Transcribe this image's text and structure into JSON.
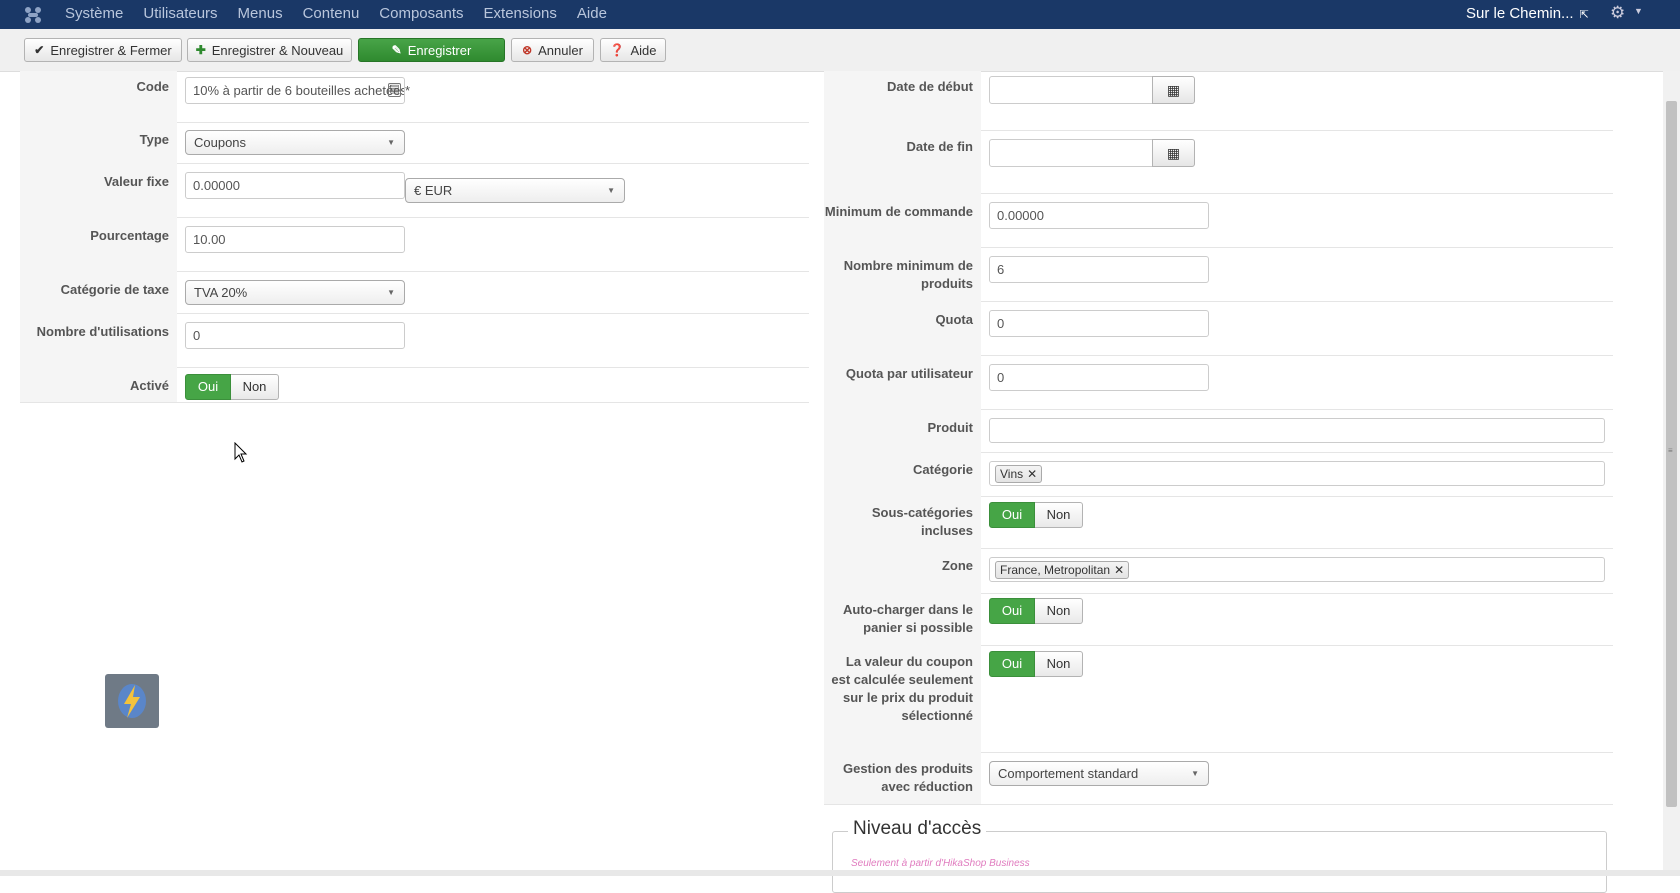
{
  "navbar": {
    "menu": [
      "Système",
      "Utilisateurs",
      "Menus",
      "Contenu",
      "Composants",
      "Extensions",
      "Aide"
    ],
    "site": "Sur le Chemin...",
    "external_icon": "external-link-icon",
    "settings_icon": "gear-icon"
  },
  "toolbar": {
    "save_close": "Enregistrer & Fermer",
    "save_new": "Enregistrer & Nouveau",
    "save": "Enregistrer",
    "cancel": "Annuler",
    "help": "Aide"
  },
  "left": {
    "code": {
      "label": "Code",
      "value": "10% à partir de 6 bouteilles achetées",
      "required": "*"
    },
    "type": {
      "label": "Type",
      "value": "Coupons"
    },
    "fixed_value": {
      "label": "Valeur fixe",
      "value": "0.00000",
      "currency": "€ EUR"
    },
    "percentage": {
      "label": "Pourcentage",
      "value": "10.00"
    },
    "tax_category": {
      "label": "Catégorie de taxe",
      "value": "TVA 20%"
    },
    "uses": {
      "label": "Nombre d'utilisations",
      "value": "0"
    },
    "active": {
      "label": "Activé",
      "yes": "Oui",
      "no": "Non",
      "state": "Oui"
    }
  },
  "right": {
    "start_date": {
      "label": "Date de début",
      "value": ""
    },
    "end_date": {
      "label": "Date de fin",
      "value": ""
    },
    "min_order": {
      "label": "Minimum de commande",
      "value": "0.00000"
    },
    "min_products": {
      "label": "Nombre minimum de produits",
      "value": "6"
    },
    "quota": {
      "label": "Quota",
      "value": "0"
    },
    "quota_user": {
      "label": "Quota par utilisateur",
      "value": "0"
    },
    "product": {
      "label": "Produit",
      "value": ""
    },
    "category": {
      "label": "Catégorie",
      "tags": [
        "Vins"
      ]
    },
    "subcategories": {
      "label": "Sous-catégories incluses",
      "yes": "Oui",
      "no": "Non",
      "state": "Oui"
    },
    "zone": {
      "label": "Zone",
      "tags": [
        "France, Metropolitan"
      ]
    },
    "autoload": {
      "label": "Auto-charger dans le panier si possible",
      "yes": "Oui",
      "no": "Non",
      "state": "Oui"
    },
    "coupon_value": {
      "label": "La valeur du coupon est calculée seulement sur le prix du produit sélectionné",
      "yes": "Oui",
      "no": "Non",
      "state": "Oui"
    },
    "discounted_products": {
      "label": "Gestion des produits avec réduction",
      "value": "Comportement standard"
    }
  },
  "access": {
    "legend": "Niveau d'accès",
    "note": "Seulement à partir d'HikaShop Business"
  },
  "colors": {
    "navbar": "#1a3867",
    "accent_green": "#46a546"
  }
}
